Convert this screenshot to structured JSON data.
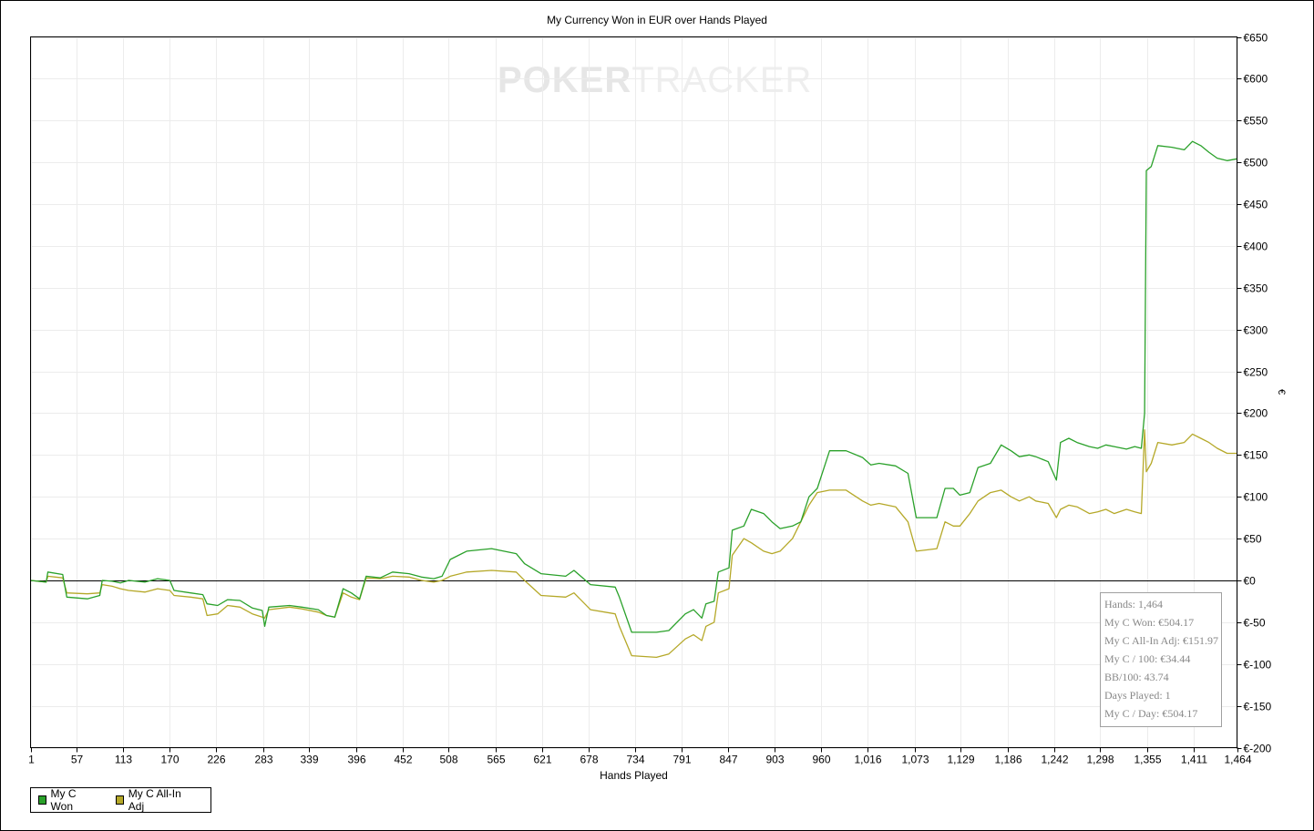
{
  "chart_data": {
    "type": "line",
    "title": "My Currency Won in EUR over Hands Played",
    "xlabel": "Hands Played",
    "ylabel": "€",
    "x_ticks": [
      1,
      57,
      113,
      170,
      226,
      283,
      339,
      396,
      452,
      508,
      565,
      621,
      678,
      734,
      791,
      847,
      903,
      960,
      1016,
      1073,
      1129,
      1186,
      1242,
      1298,
      1355,
      1411,
      1464
    ],
    "x_tick_labels": [
      "1",
      "57",
      "113",
      "170",
      "226",
      "283",
      "339",
      "396",
      "452",
      "508",
      "565",
      "621",
      "678",
      "734",
      "791",
      "847",
      "903",
      "960",
      "1,016",
      "1,073",
      "1,129",
      "1,186",
      "1,242",
      "1,298",
      "1,355",
      "1,411",
      "1,464"
    ],
    "xlim": [
      1,
      1464
    ],
    "y_ticks": [
      650,
      600,
      550,
      500,
      450,
      400,
      350,
      300,
      250,
      200,
      150,
      100,
      50,
      0,
      -50,
      -100,
      -150,
      -200
    ],
    "y_tick_labels": [
      "€650",
      "€600",
      "€550",
      "€500",
      "€450",
      "€400",
      "€350",
      "€300",
      "€250",
      "€200",
      "€150",
      "€100",
      "€50",
      "€0",
      "€-50",
      "€-100",
      "€-150",
      "€-200"
    ],
    "ylim": [
      -200,
      650
    ],
    "grid": true,
    "legend_position": "bottom-left",
    "series": [
      {
        "name": "My C Won",
        "color": "#2aa12a",
        "points": [
          [
            1,
            0
          ],
          [
            20,
            -2
          ],
          [
            22,
            10
          ],
          [
            40,
            7
          ],
          [
            45,
            -20
          ],
          [
            70,
            -22
          ],
          [
            85,
            -18
          ],
          [
            88,
            0
          ],
          [
            100,
            -1
          ],
          [
            110,
            -3
          ],
          [
            120,
            0
          ],
          [
            140,
            -2
          ],
          [
            155,
            2
          ],
          [
            170,
            0
          ],
          [
            175,
            -12
          ],
          [
            195,
            -15
          ],
          [
            210,
            -17
          ],
          [
            215,
            -28
          ],
          [
            228,
            -30
          ],
          [
            240,
            -23
          ],
          [
            255,
            -24
          ],
          [
            270,
            -33
          ],
          [
            282,
            -36
          ],
          [
            285,
            -55
          ],
          [
            290,
            -32
          ],
          [
            315,
            -30
          ],
          [
            330,
            -32
          ],
          [
            350,
            -35
          ],
          [
            360,
            -42
          ],
          [
            370,
            -44
          ],
          [
            380,
            -10
          ],
          [
            390,
            -15
          ],
          [
            400,
            -22
          ],
          [
            408,
            5
          ],
          [
            425,
            3
          ],
          [
            440,
            10
          ],
          [
            460,
            8
          ],
          [
            475,
            4
          ],
          [
            490,
            2
          ],
          [
            500,
            5
          ],
          [
            510,
            25
          ],
          [
            530,
            35
          ],
          [
            560,
            38
          ],
          [
            590,
            32
          ],
          [
            600,
            20
          ],
          [
            620,
            8
          ],
          [
            650,
            5
          ],
          [
            660,
            12
          ],
          [
            680,
            -5
          ],
          [
            710,
            -8
          ],
          [
            715,
            -20
          ],
          [
            730,
            -62
          ],
          [
            760,
            -62
          ],
          [
            775,
            -60
          ],
          [
            795,
            -40
          ],
          [
            805,
            -35
          ],
          [
            815,
            -45
          ],
          [
            820,
            -28
          ],
          [
            830,
            -25
          ],
          [
            835,
            10
          ],
          [
            848,
            15
          ],
          [
            852,
            60
          ],
          [
            866,
            65
          ],
          [
            875,
            85
          ],
          [
            890,
            80
          ],
          [
            900,
            70
          ],
          [
            910,
            62
          ],
          [
            925,
            65
          ],
          [
            935,
            70
          ],
          [
            945,
            100
          ],
          [
            955,
            110
          ],
          [
            970,
            155
          ],
          [
            990,
            155
          ],
          [
            1010,
            147
          ],
          [
            1020,
            138
          ],
          [
            1030,
            140
          ],
          [
            1050,
            137
          ],
          [
            1065,
            128
          ],
          [
            1075,
            75
          ],
          [
            1100,
            75
          ],
          [
            1110,
            110
          ],
          [
            1120,
            110
          ],
          [
            1128,
            102
          ],
          [
            1140,
            105
          ],
          [
            1150,
            135
          ],
          [
            1165,
            140
          ],
          [
            1178,
            162
          ],
          [
            1190,
            155
          ],
          [
            1200,
            148
          ],
          [
            1212,
            150
          ],
          [
            1220,
            148
          ],
          [
            1235,
            142
          ],
          [
            1245,
            120
          ],
          [
            1250,
            165
          ],
          [
            1260,
            170
          ],
          [
            1270,
            165
          ],
          [
            1285,
            160
          ],
          [
            1295,
            158
          ],
          [
            1305,
            162
          ],
          [
            1315,
            160
          ],
          [
            1330,
            157
          ],
          [
            1340,
            160
          ],
          [
            1348,
            158
          ],
          [
            1352,
            200
          ],
          [
            1354,
            490
          ],
          [
            1360,
            495
          ],
          [
            1368,
            520
          ],
          [
            1385,
            518
          ],
          [
            1400,
            515
          ],
          [
            1410,
            525
          ],
          [
            1420,
            520
          ],
          [
            1430,
            512
          ],
          [
            1440,
            505
          ],
          [
            1452,
            502
          ],
          [
            1464,
            504.17
          ]
        ]
      },
      {
        "name": "My C All-In Adj",
        "color": "#b5a828",
        "points": [
          [
            1,
            0
          ],
          [
            20,
            -2
          ],
          [
            22,
            5
          ],
          [
            40,
            3
          ],
          [
            45,
            -15
          ],
          [
            70,
            -16
          ],
          [
            85,
            -15
          ],
          [
            88,
            -5
          ],
          [
            100,
            -7
          ],
          [
            110,
            -10
          ],
          [
            120,
            -12
          ],
          [
            140,
            -14
          ],
          [
            155,
            -10
          ],
          [
            170,
            -12
          ],
          [
            175,
            -18
          ],
          [
            195,
            -20
          ],
          [
            210,
            -22
          ],
          [
            215,
            -42
          ],
          [
            228,
            -40
          ],
          [
            240,
            -30
          ],
          [
            255,
            -32
          ],
          [
            270,
            -40
          ],
          [
            282,
            -44
          ],
          [
            285,
            -45
          ],
          [
            290,
            -35
          ],
          [
            315,
            -32
          ],
          [
            330,
            -34
          ],
          [
            350,
            -38
          ],
          [
            360,
            -42
          ],
          [
            370,
            -44
          ],
          [
            380,
            -15
          ],
          [
            390,
            -20
          ],
          [
            400,
            -23
          ],
          [
            408,
            3
          ],
          [
            425,
            2
          ],
          [
            440,
            5
          ],
          [
            460,
            4
          ],
          [
            475,
            0
          ],
          [
            490,
            -2
          ],
          [
            500,
            0
          ],
          [
            510,
            5
          ],
          [
            530,
            10
          ],
          [
            560,
            12
          ],
          [
            590,
            10
          ],
          [
            600,
            0
          ],
          [
            620,
            -18
          ],
          [
            650,
            -20
          ],
          [
            660,
            -15
          ],
          [
            680,
            -35
          ],
          [
            710,
            -40
          ],
          [
            715,
            -55
          ],
          [
            730,
            -90
          ],
          [
            760,
            -92
          ],
          [
            775,
            -88
          ],
          [
            795,
            -70
          ],
          [
            805,
            -65
          ],
          [
            815,
            -72
          ],
          [
            820,
            -55
          ],
          [
            830,
            -50
          ],
          [
            835,
            -15
          ],
          [
            848,
            -10
          ],
          [
            852,
            30
          ],
          [
            866,
            50
          ],
          [
            875,
            45
          ],
          [
            890,
            35
          ],
          [
            900,
            32
          ],
          [
            910,
            35
          ],
          [
            925,
            50
          ],
          [
            935,
            70
          ],
          [
            945,
            90
          ],
          [
            955,
            105
          ],
          [
            970,
            108
          ],
          [
            990,
            108
          ],
          [
            1010,
            95
          ],
          [
            1020,
            90
          ],
          [
            1030,
            92
          ],
          [
            1050,
            88
          ],
          [
            1065,
            70
          ],
          [
            1075,
            35
          ],
          [
            1100,
            38
          ],
          [
            1110,
            70
          ],
          [
            1120,
            65
          ],
          [
            1128,
            65
          ],
          [
            1140,
            80
          ],
          [
            1150,
            95
          ],
          [
            1165,
            105
          ],
          [
            1178,
            108
          ],
          [
            1190,
            100
          ],
          [
            1200,
            95
          ],
          [
            1212,
            100
          ],
          [
            1220,
            95
          ],
          [
            1235,
            92
          ],
          [
            1245,
            75
          ],
          [
            1250,
            85
          ],
          [
            1260,
            90
          ],
          [
            1270,
            88
          ],
          [
            1285,
            80
          ],
          [
            1295,
            82
          ],
          [
            1305,
            85
          ],
          [
            1315,
            80
          ],
          [
            1330,
            85
          ],
          [
            1340,
            82
          ],
          [
            1348,
            80
          ],
          [
            1352,
            180
          ],
          [
            1354,
            130
          ],
          [
            1360,
            140
          ],
          [
            1368,
            165
          ],
          [
            1385,
            162
          ],
          [
            1400,
            165
          ],
          [
            1410,
            175
          ],
          [
            1420,
            170
          ],
          [
            1430,
            165
          ],
          [
            1440,
            158
          ],
          [
            1452,
            152
          ],
          [
            1464,
            151.97
          ]
        ]
      }
    ],
    "summary": {
      "hands": "Hands: 1,464",
      "won": "My C Won: €504.17",
      "allin_adj": "My C All-In Adj: €151.97",
      "per100": "My C / 100: €34.44",
      "bb100": "BB/100: 43.74",
      "days": "Days Played: 1",
      "per_day": "My C / Day: €504.17"
    }
  },
  "watermark": {
    "part1": "POKER",
    "part2": "TRACKER"
  }
}
